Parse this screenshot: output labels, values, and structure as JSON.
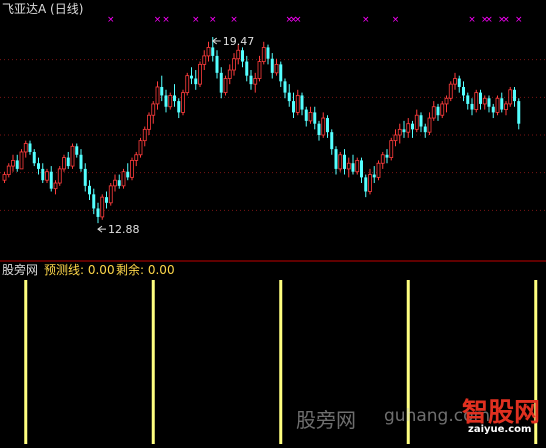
{
  "title": "飞亚达A (日线)",
  "indicator": {
    "name": "股旁网",
    "predict_label": "预测线: 0.00",
    "remain_label": "剩余: 0.00"
  },
  "watermarks": {
    "site_cn": "股旁网",
    "site_url": "guhang.com",
    "logo_cn": "智股网",
    "logo_url": "zaiyue.com"
  },
  "colors": {
    "up": "#ff3c3c",
    "down": "#54ffff",
    "signal": "#ffff80",
    "marker": "#ff00ff",
    "grid": "#7a1414",
    "divider": "#c00000"
  },
  "chart_data": [
    {
      "type": "candlestick",
      "title": "飞亚达A (日线)",
      "ylim": [
        12.0,
        20.0
      ],
      "annotations": [
        {
          "text": "19.47",
          "index": 49,
          "value": 19.47
        },
        {
          "text": "12.88",
          "index": 22,
          "value": 12.88
        }
      ],
      "markers_top": [
        25,
        36,
        38,
        45,
        49,
        54,
        67,
        68,
        69,
        85,
        92,
        110,
        113,
        114,
        117,
        118,
        121
      ],
      "grid": true,
      "candles": [
        [
          14.4,
          14.7,
          14.3,
          14.6
        ],
        [
          14.6,
          15.0,
          14.5,
          14.9
        ],
        [
          14.9,
          15.3,
          14.7,
          15.1
        ],
        [
          15.1,
          15.3,
          14.7,
          14.8
        ],
        [
          14.8,
          15.5,
          14.8,
          15.4
        ],
        [
          15.4,
          15.8,
          15.2,
          15.7
        ],
        [
          15.7,
          15.8,
          15.3,
          15.4
        ],
        [
          15.4,
          15.5,
          14.9,
          15.0
        ],
        [
          15.0,
          15.2,
          14.6,
          14.8
        ],
        [
          14.8,
          15.0,
          14.3,
          14.4
        ],
        [
          14.4,
          14.8,
          14.3,
          14.7
        ],
        [
          14.7,
          14.9,
          14.0,
          14.1
        ],
        [
          14.1,
          14.4,
          13.9,
          14.3
        ],
        [
          14.3,
          14.9,
          14.2,
          14.8
        ],
        [
          14.8,
          15.3,
          14.7,
          15.2
        ],
        [
          15.2,
          15.4,
          14.8,
          14.9
        ],
        [
          14.9,
          15.7,
          14.8,
          15.6
        ],
        [
          15.6,
          15.7,
          15.2,
          15.3
        ],
        [
          15.3,
          15.5,
          14.7,
          14.8
        ],
        [
          14.8,
          15.0,
          14.0,
          14.2
        ],
        [
          14.2,
          14.4,
          13.7,
          13.9
        ],
        [
          13.9,
          14.1,
          13.2,
          13.4
        ],
        [
          13.4,
          13.6,
          12.88,
          13.1
        ],
        [
          13.1,
          13.9,
          13.0,
          13.8
        ],
        [
          13.8,
          14.0,
          13.4,
          13.6
        ],
        [
          13.6,
          14.3,
          13.5,
          14.2
        ],
        [
          14.2,
          14.6,
          14.0,
          14.4
        ],
        [
          14.4,
          14.6,
          14.1,
          14.2
        ],
        [
          14.2,
          14.8,
          14.1,
          14.7
        ],
        [
          14.7,
          15.0,
          14.4,
          14.5
        ],
        [
          14.5,
          15.2,
          14.4,
          15.1
        ],
        [
          15.1,
          15.4,
          14.9,
          15.3
        ],
        [
          15.3,
          15.9,
          15.2,
          15.8
        ],
        [
          15.8,
          16.3,
          15.6,
          16.2
        ],
        [
          16.2,
          16.8,
          16.0,
          16.7
        ],
        [
          16.7,
          17.2,
          16.4,
          17.1
        ],
        [
          17.1,
          17.9,
          16.9,
          17.7
        ],
        [
          17.7,
          18.1,
          17.2,
          17.4
        ],
        [
          17.4,
          17.6,
          16.8,
          17.0
        ],
        [
          17.0,
          17.5,
          16.9,
          17.4
        ],
        [
          17.4,
          17.8,
          17.0,
          17.2
        ],
        [
          17.2,
          17.3,
          16.6,
          16.8
        ],
        [
          16.8,
          17.6,
          16.7,
          17.5
        ],
        [
          17.5,
          18.2,
          17.4,
          18.1
        ],
        [
          18.1,
          18.4,
          17.8,
          18.0
        ],
        [
          18.0,
          18.3,
          17.6,
          17.8
        ],
        [
          17.8,
          18.6,
          17.7,
          18.5
        ],
        [
          18.5,
          19.0,
          18.3,
          18.8
        ],
        [
          18.8,
          19.3,
          18.6,
          19.1
        ],
        [
          19.1,
          19.47,
          18.6,
          18.8
        ],
        [
          18.8,
          19.0,
          18.0,
          18.2
        ],
        [
          18.2,
          18.4,
          17.3,
          17.5
        ],
        [
          17.5,
          18.1,
          17.4,
          18.0
        ],
        [
          18.0,
          18.5,
          17.8,
          18.3
        ],
        [
          18.3,
          18.9,
          18.1,
          18.7
        ],
        [
          18.7,
          19.2,
          18.5,
          19.0
        ],
        [
          19.0,
          19.1,
          18.4,
          18.6
        ],
        [
          18.6,
          18.8,
          17.9,
          18.1
        ],
        [
          18.1,
          18.3,
          17.6,
          17.8
        ],
        [
          17.8,
          18.2,
          17.5,
          18.0
        ],
        [
          18.0,
          18.8,
          17.9,
          18.6
        ],
        [
          18.6,
          19.3,
          18.5,
          19.1
        ],
        [
          19.1,
          19.2,
          18.5,
          18.7
        ],
        [
          18.7,
          18.9,
          18.0,
          18.2
        ],
        [
          18.2,
          18.7,
          18.1,
          18.5
        ],
        [
          18.5,
          18.6,
          17.7,
          17.9
        ],
        [
          17.9,
          18.0,
          17.3,
          17.5
        ],
        [
          17.5,
          17.8,
          17.0,
          17.2
        ],
        [
          17.2,
          17.5,
          16.6,
          16.8
        ],
        [
          16.8,
          17.6,
          16.7,
          17.4
        ],
        [
          17.4,
          17.5,
          16.7,
          16.9
        ],
        [
          16.9,
          17.0,
          16.3,
          16.5
        ],
        [
          16.5,
          17.0,
          16.4,
          16.8
        ],
        [
          16.8,
          17.0,
          16.2,
          16.4
        ],
        [
          16.4,
          16.5,
          15.8,
          16.0
        ],
        [
          16.0,
          16.8,
          15.9,
          16.6
        ],
        [
          16.6,
          16.7,
          15.9,
          16.1
        ],
        [
          16.1,
          16.2,
          15.3,
          15.5
        ],
        [
          15.5,
          15.6,
          14.6,
          14.8
        ],
        [
          14.8,
          15.4,
          14.7,
          15.3
        ],
        [
          15.3,
          15.5,
          14.6,
          14.8
        ],
        [
          14.8,
          15.2,
          14.5,
          15.0
        ],
        [
          15.0,
          15.3,
          14.6,
          14.7
        ],
        [
          14.7,
          15.2,
          14.6,
          15.1
        ],
        [
          15.1,
          15.2,
          14.3,
          14.5
        ],
        [
          14.5,
          14.6,
          13.8,
          14.0
        ],
        [
          14.0,
          14.8,
          13.9,
          14.6
        ],
        [
          14.6,
          14.9,
          14.3,
          14.5
        ],
        [
          14.5,
          15.1,
          14.4,
          15.0
        ],
        [
          15.0,
          15.4,
          14.8,
          15.3
        ],
        [
          15.3,
          15.5,
          15.0,
          15.2
        ],
        [
          15.2,
          15.9,
          15.1,
          15.8
        ],
        [
          15.8,
          16.2,
          15.6,
          16.0
        ],
        [
          16.0,
          16.4,
          15.7,
          16.2
        ],
        [
          16.2,
          16.5,
          15.9,
          16.1
        ],
        [
          16.1,
          16.6,
          15.9,
          16.4
        ],
        [
          16.4,
          16.5,
          15.9,
          16.2
        ],
        [
          16.2,
          16.9,
          16.1,
          16.7
        ],
        [
          16.7,
          16.8,
          16.1,
          16.3
        ],
        [
          16.3,
          16.4,
          15.9,
          16.1
        ],
        [
          16.1,
          16.8,
          16.0,
          16.6
        ],
        [
          16.6,
          17.2,
          16.5,
          17.0
        ],
        [
          17.0,
          17.1,
          16.5,
          16.7
        ],
        [
          16.7,
          17.2,
          16.6,
          17.1
        ],
        [
          17.1,
          17.4,
          16.8,
          17.3
        ],
        [
          17.3,
          17.9,
          17.2,
          17.8
        ],
        [
          17.8,
          18.2,
          17.6,
          18.0
        ],
        [
          18.0,
          18.1,
          17.5,
          17.7
        ],
        [
          17.7,
          17.9,
          17.2,
          17.4
        ],
        [
          17.4,
          17.5,
          16.9,
          17.1
        ],
        [
          17.1,
          17.3,
          16.7,
          16.9
        ],
        [
          16.9,
          17.6,
          16.8,
          17.5
        ],
        [
          17.5,
          17.6,
          16.9,
          17.1
        ],
        [
          17.1,
          17.4,
          16.9,
          17.3
        ],
        [
          17.3,
          17.4,
          16.8,
          17.0
        ],
        [
          17.0,
          17.1,
          16.6,
          16.8
        ],
        [
          16.8,
          17.4,
          16.7,
          17.3
        ],
        [
          17.3,
          17.5,
          16.8,
          16.9
        ],
        [
          16.9,
          17.2,
          16.7,
          17.1
        ],
        [
          17.1,
          17.7,
          17.0,
          17.6
        ],
        [
          17.6,
          17.7,
          17.0,
          17.2
        ],
        [
          17.2,
          17.3,
          16.2,
          16.4
        ]
      ]
    },
    {
      "type": "bar",
      "title": "股旁网",
      "series": [
        {
          "name": "预测线",
          "values": [
            0.0
          ]
        },
        {
          "name": "剩余",
          "values": [
            0.0
          ]
        }
      ],
      "signal_bars": [
        5,
        35,
        65,
        95,
        125
      ]
    }
  ]
}
